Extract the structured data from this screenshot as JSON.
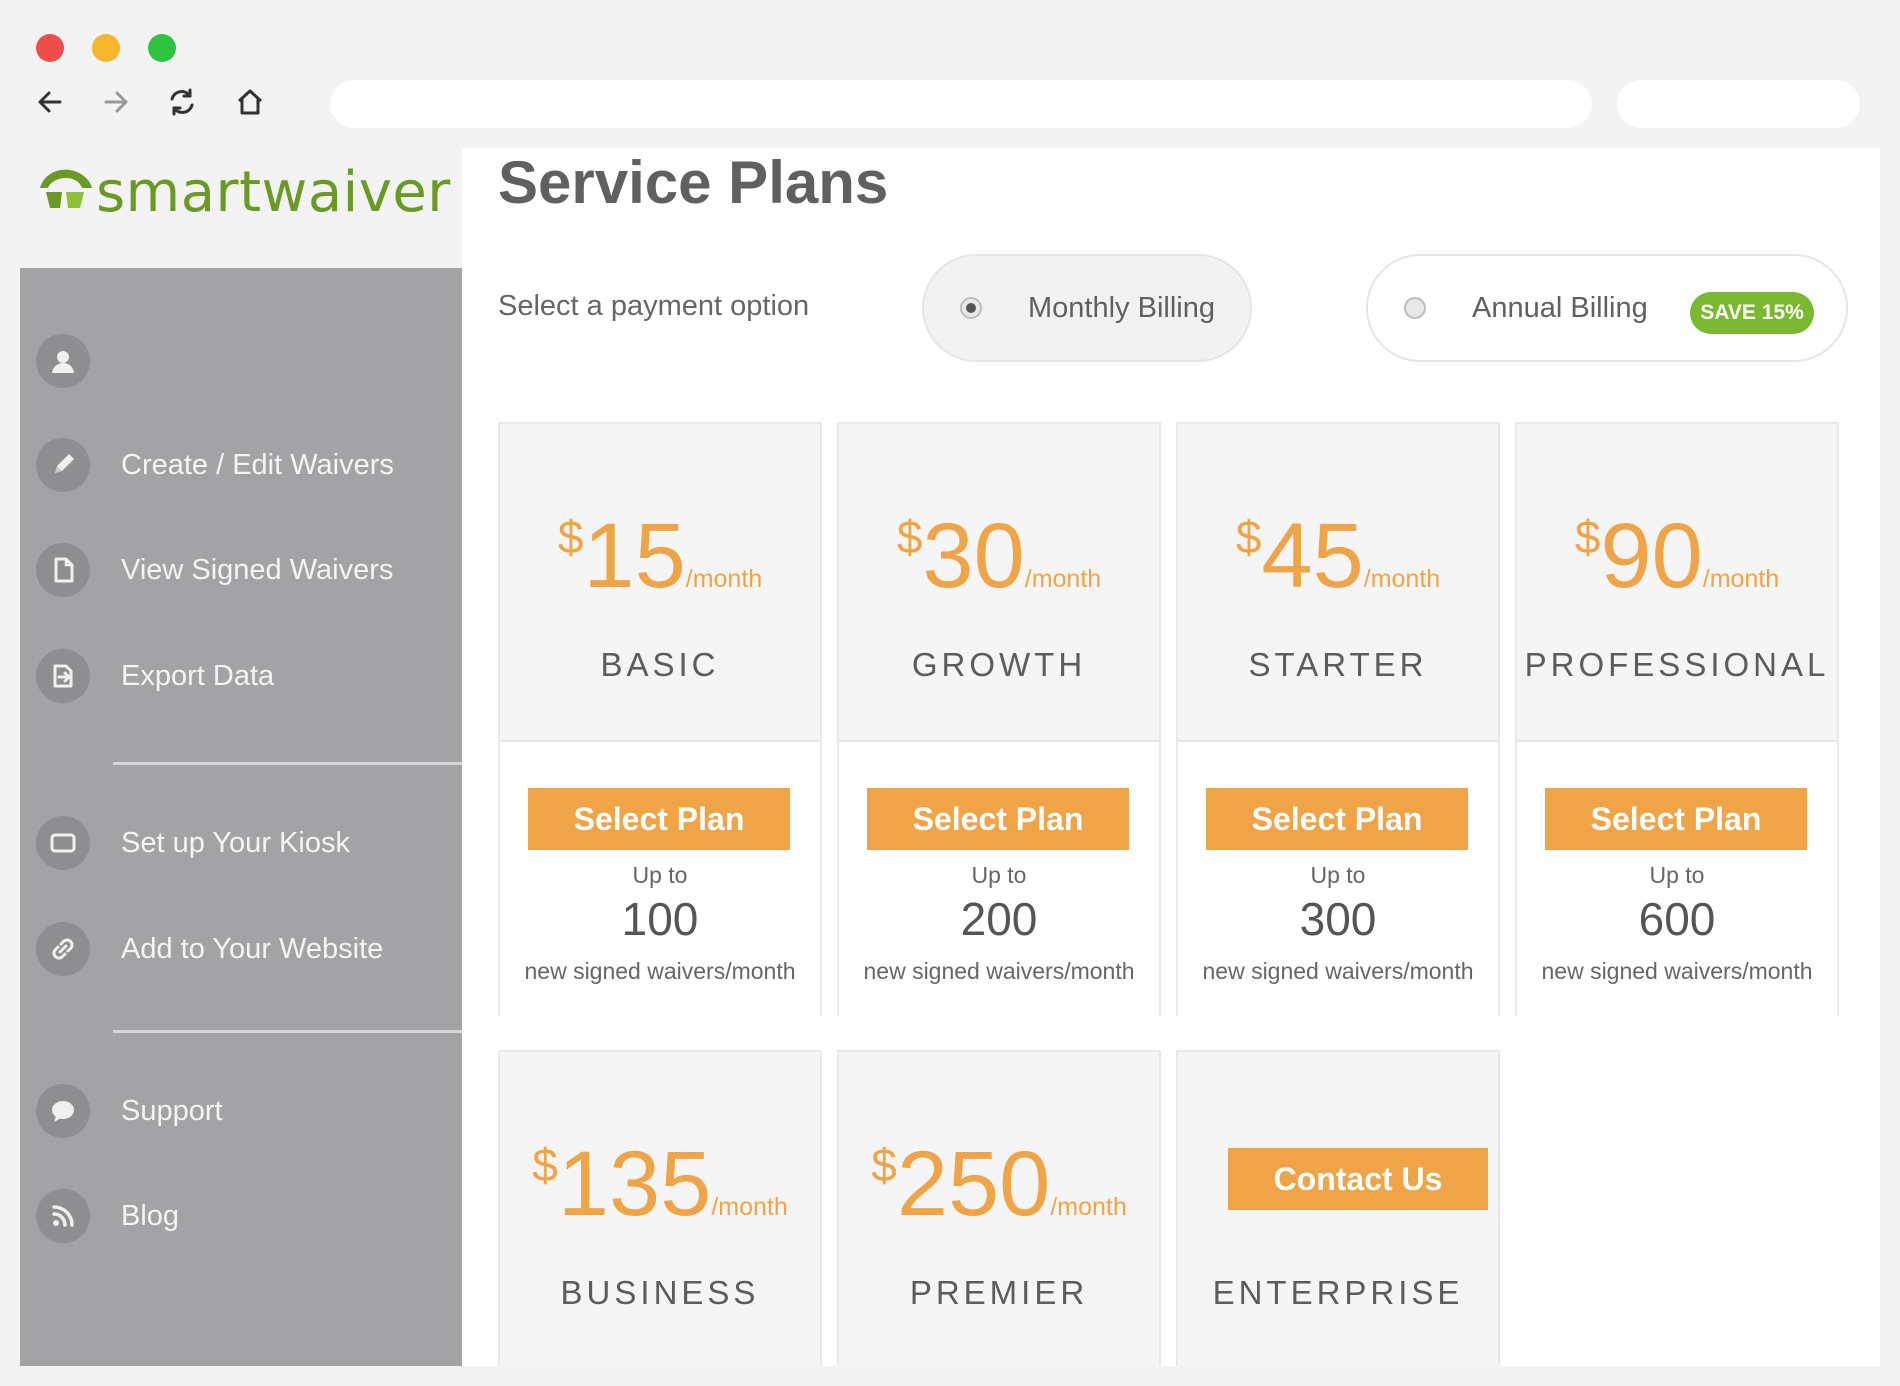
{
  "logo": {
    "text": "smartwaiver"
  },
  "sidebar": {
    "items": [
      {
        "label": "",
        "icon": "user-icon"
      },
      {
        "label": "Create / Edit Waivers",
        "icon": "pencil-icon"
      },
      {
        "label": "View Signed Waivers",
        "icon": "document-icon"
      },
      {
        "label": "Export Data",
        "icon": "export-icon"
      },
      {
        "label": "Set up Your Kiosk",
        "icon": "tablet-icon"
      },
      {
        "label": "Add to Your Website",
        "icon": "link-icon"
      },
      {
        "label": "Support",
        "icon": "chat-bubble-icon"
      },
      {
        "label": "Blog",
        "icon": "rss-icon"
      }
    ]
  },
  "main": {
    "title": "Service Plans",
    "payment_label": "Select a payment option",
    "billing": {
      "monthly": {
        "label": "Monthly Billing",
        "selected": true
      },
      "annual": {
        "label": "Annual Billing",
        "selected": false,
        "badge": "SAVE 15%"
      }
    }
  },
  "plans": [
    {
      "currency": "$",
      "price": "15",
      "period": "/month",
      "name": "BASIC",
      "button": "Select Plan",
      "upto": "Up to",
      "count": "100",
      "desc": "new signed waivers/month"
    },
    {
      "currency": "$",
      "price": "30",
      "period": "/month",
      "name": "GROWTH",
      "button": "Select Plan",
      "upto": "Up to",
      "count": "200",
      "desc": "new signed waivers/month"
    },
    {
      "currency": "$",
      "price": "45",
      "period": "/month",
      "name": "STARTER",
      "button": "Select Plan",
      "upto": "Up to",
      "count": "300",
      "desc": "new signed waivers/month"
    },
    {
      "currency": "$",
      "price": "90",
      "period": "/month",
      "name": "PROFESSIONAL",
      "button": "Select Plan",
      "upto": "Up to",
      "count": "600",
      "desc": "new signed waivers/month"
    },
    {
      "currency": "$",
      "price": "135",
      "period": "/month",
      "name": "BUSINESS"
    },
    {
      "currency": "$",
      "price": "250",
      "period": "/month",
      "name": "PREMIER"
    },
    {
      "name": "ENTERPRISE",
      "button": "Contact Us"
    }
  ],
  "colors": {
    "accent": "#efa447",
    "brand": "#6a9a24",
    "badge": "#7ab832",
    "sidebar": "#a3a3a5"
  }
}
